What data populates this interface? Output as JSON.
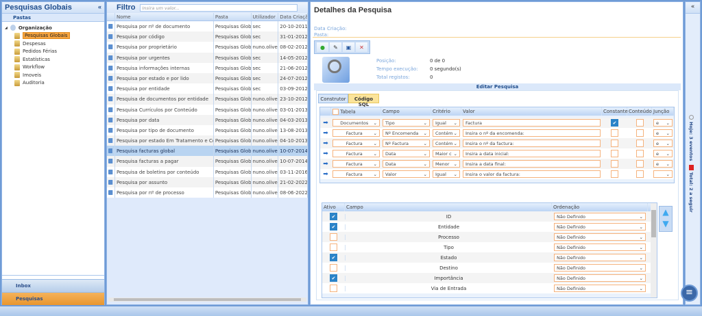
{
  "left": {
    "title": "Pesquisas Globais",
    "collapse": "«",
    "subtitle": "Pastas",
    "root": "Organização",
    "folders": [
      "Pesquisas Globais",
      "Despesas",
      "Pedidos Férias",
      "Estatísticas",
      "Workflow",
      "Imoveis",
      "Auditoria"
    ],
    "inbox": "Inbox",
    "pesquisas": "Pesquisas"
  },
  "middle": {
    "title": "Filtro",
    "placeholder": "Insira um valor...",
    "columns": [
      "Nome",
      "Pasta",
      "Utilizador",
      "Data Criação"
    ],
    "rows": [
      [
        "Pesquisa por nº de documento",
        "Pesquisas Globais",
        "sec",
        "20-10-2011"
      ],
      [
        "Pesquisa por código",
        "Pesquisas Globais",
        "sec",
        "31-01-2012"
      ],
      [
        "Pesquisa por proprietário",
        "Pesquisas Globais",
        "nuno.oliveira",
        "08-02-2012"
      ],
      [
        "Pesquisa por urgentes",
        "Pesquisas Globais",
        "sec",
        "14-05-2012"
      ],
      [
        "Pesquisa informações internas",
        "Pesquisas Globais",
        "sec",
        "21-06-2012"
      ],
      [
        "Pesquisa por estado e por lido",
        "Pesquisas Globais",
        "sec",
        "24-07-2012"
      ],
      [
        "Pesquisa por entidade",
        "Pesquisas Globais",
        "sec",
        "03-09-2012"
      ],
      [
        "Pesquisa de documentos por entidade",
        "Pesquisas Globais",
        "nuno.oliveira",
        "23-10-2012"
      ],
      [
        "Pesquisa Currículos por Conteúdo",
        "Pesquisas Globais",
        "nuno.oliveira",
        "03-01-2013"
      ],
      [
        "Pesquisa por data",
        "Pesquisas Globais",
        "nuno.oliveira",
        "04-03-2013"
      ],
      [
        "Pesquisa por tipo de documento",
        "Pesquisas Globais",
        "nuno.oliveira",
        "13-08-2013"
      ],
      [
        "Pesquisa por estado Em Tratamento e Concluido",
        "Pesquisas Globais",
        "nuno.oliveira",
        "04-10-2013"
      ],
      [
        "Pesquisa facturas global",
        "Pesquisas Globais",
        "nuno.oliveira",
        "10-07-2014"
      ],
      [
        "Pesquisa facturas a pagar",
        "Pesquisas Globais",
        "nuno.oliveira",
        "10-07-2014"
      ],
      [
        "Pesquisa de boletins por conteúdo",
        "Pesquisas Globais",
        "nuno.oliveira",
        "03-11-2016"
      ],
      [
        "Pesquisa por assunto",
        "Pesquisas Globais",
        "nuno.oliveira",
        "21-02-2022"
      ],
      [
        "Pesquisa por nº de processo",
        "Pesquisas Globais",
        "nuno.oliveira",
        "08-06-2022"
      ]
    ],
    "selected_index": 12
  },
  "details": {
    "title": "Detalhes da Pesquisa",
    "data_criacao": "Data Criação:",
    "pasta": "Pasta:",
    "posicao_label": "Posição:",
    "posicao": "0 de 0",
    "tempo_label": "Tempo execução:",
    "tempo": "0 segundo(s)",
    "total_label": "Total registos:",
    "total": "0",
    "editar": "Editar Pesquisa",
    "tabs": [
      "Construtor",
      "Código SQL"
    ],
    "criteria_columns": [
      "Tabela",
      "Campo",
      "Critério",
      "Valor",
      "Constante",
      "Conteúdo",
      "Junção"
    ],
    "criteria": [
      {
        "tabela": "Documentos",
        "campo": "Tipo",
        "criterio": "Igual",
        "valor": "Factura",
        "constante": true,
        "conteudo": false,
        "juncao": "e"
      },
      {
        "tabela": "Factura",
        "campo": "Nº Encomenda",
        "criterio": "Contém",
        "valor": "Insira o nº da encomenda:",
        "constante": false,
        "conteudo": false,
        "juncao": "e"
      },
      {
        "tabela": "Factura",
        "campo": "Nº Factura",
        "criterio": "Contém",
        "valor": "Insira o nº da factura:",
        "constante": false,
        "conteudo": false,
        "juncao": "e"
      },
      {
        "tabela": "Factura",
        "campo": "Data",
        "criterio": "Maior c",
        "valor": "Insira  a data inicial:",
        "constante": false,
        "conteudo": false,
        "juncao": "e"
      },
      {
        "tabela": "Factura",
        "campo": "Data",
        "criterio": "Menor",
        "valor": "Insira a data final:",
        "constante": false,
        "conteudo": false,
        "juncao": "e"
      },
      {
        "tabela": "Factura",
        "campo": "Valor",
        "criterio": "Igual",
        "valor": "Insira o valor da factura:",
        "constante": false,
        "conteudo": false,
        "juncao": ""
      }
    ],
    "fields_columns": [
      "Ativo",
      "Campo",
      "Ordenação"
    ],
    "fields": [
      {
        "ativo": true,
        "campo": "ID",
        "ordenacao": "Não Definido"
      },
      {
        "ativo": true,
        "campo": "Entidade",
        "ordenacao": "Não Definido"
      },
      {
        "ativo": false,
        "campo": "Processo",
        "ordenacao": "Não Definido"
      },
      {
        "ativo": false,
        "campo": "Tipo",
        "ordenacao": "Não Definido"
      },
      {
        "ativo": true,
        "campo": "Estado",
        "ordenacao": "Não Definido"
      },
      {
        "ativo": false,
        "campo": "Destino",
        "ordenacao": "Não Definido"
      },
      {
        "ativo": true,
        "campo": "Importância",
        "ordenacao": "Não Definido"
      },
      {
        "ativo": false,
        "campo": "Via de Entrada",
        "ordenacao": "Não Definido"
      }
    ]
  },
  "side": {
    "collapse": "«",
    "hoje": "Hoje: 3 eventos",
    "total": "Total: 2 a seguir"
  }
}
